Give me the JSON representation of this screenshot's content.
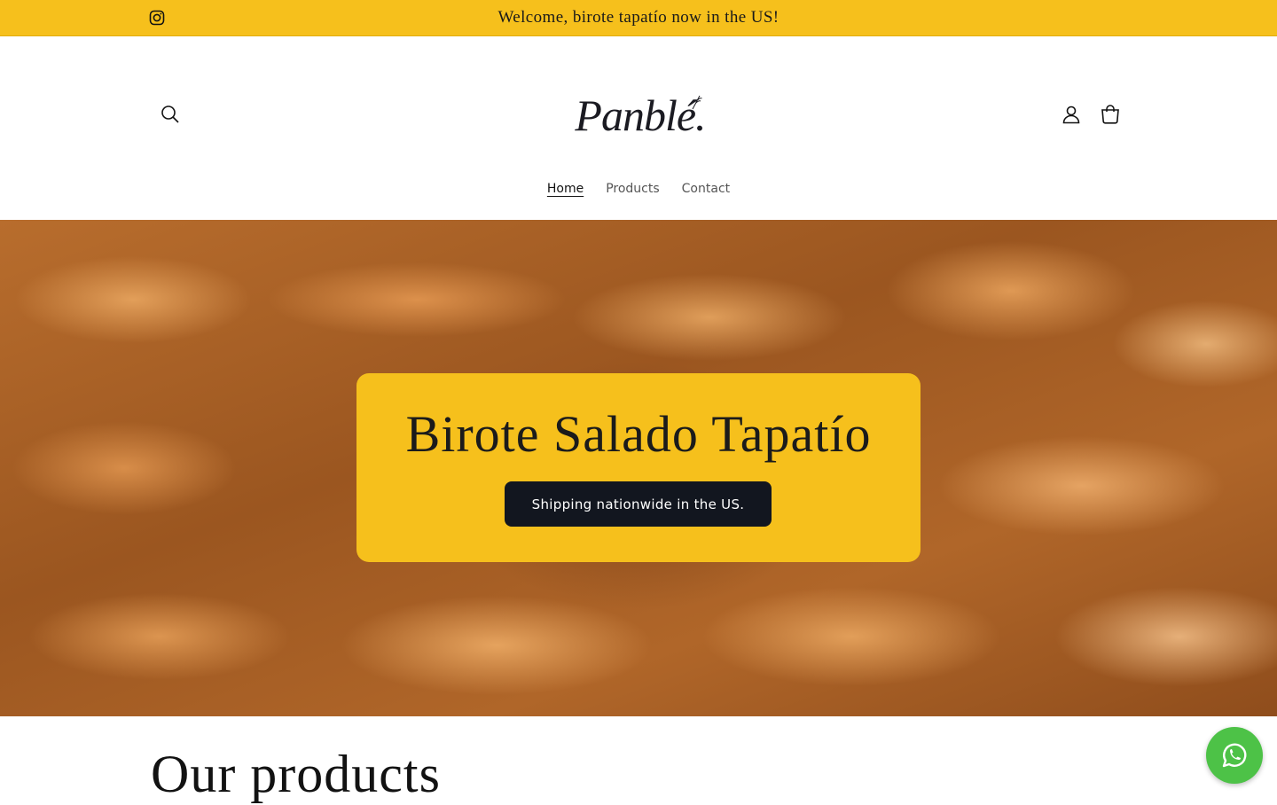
{
  "announcement": {
    "text": "Welcome, birote tapatío now in the US!",
    "social_icon": "instagram-icon"
  },
  "header": {
    "logo_text": "Panblé.",
    "icons": [
      "search-icon",
      "account-icon",
      "cart-icon"
    ]
  },
  "nav": {
    "items": [
      {
        "label": "Home",
        "active": true
      },
      {
        "label": "Products",
        "active": false
      },
      {
        "label": "Contact",
        "active": false
      }
    ]
  },
  "hero": {
    "title": "Birote Salado Tapatío",
    "button_label": "Shipping nationwide in the US."
  },
  "products": {
    "heading": "Our products"
  },
  "floating": {
    "icon": "whatsapp-icon"
  },
  "colors": {
    "accent": "#f6c01c",
    "button_dark": "#12161f",
    "whatsapp": "#4dc247"
  }
}
